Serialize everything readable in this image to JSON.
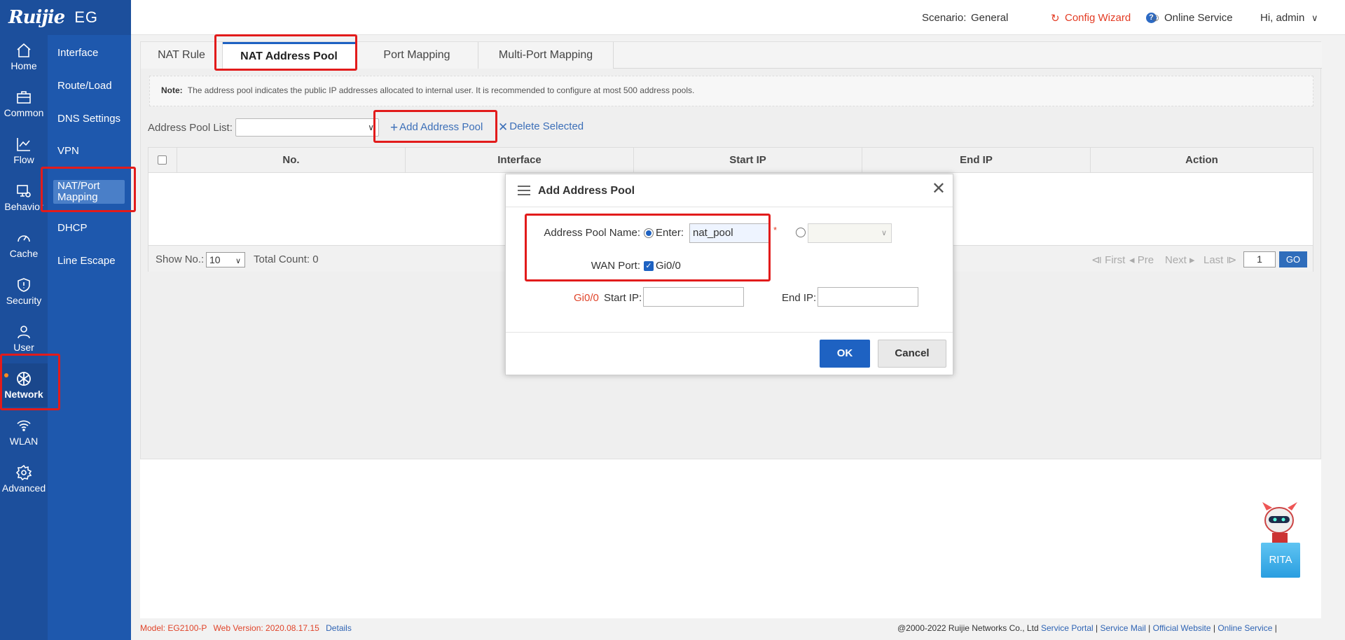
{
  "brand": {
    "logo_text": "Ruijie",
    "product": "EG"
  },
  "top_bar": {
    "scenario_label": "Scenario:",
    "scenario_value": "General",
    "config_wizard": "Config Wizard",
    "online_service": "Online Service",
    "user_greeting": "Hi, admin"
  },
  "left_nav": [
    {
      "label": "Home",
      "icon": "home-icon"
    },
    {
      "label": "Common",
      "icon": "briefcase-icon"
    },
    {
      "label": "Flow",
      "icon": "line-chart-icon"
    },
    {
      "label": "Behavior",
      "icon": "monitor-gear-icon"
    },
    {
      "label": "Cache",
      "icon": "gauge-icon"
    },
    {
      "label": "Security",
      "icon": "shield-icon"
    },
    {
      "label": "User",
      "icon": "user-icon"
    },
    {
      "label": "Network",
      "icon": "globe-icon",
      "active": true
    },
    {
      "label": "WLAN",
      "icon": "wifi-icon"
    },
    {
      "label": "Advanced",
      "icon": "gear-icon"
    }
  ],
  "sub_nav": [
    "Interface",
    "Route/Load",
    "DNS Settings",
    "VPN",
    "NAT/Port Mapping",
    "DHCP",
    "Line Escape"
  ],
  "tabs": [
    "NAT Rule",
    "NAT Address Pool",
    "Port Mapping",
    "Multi-Port Mapping"
  ],
  "note": {
    "label": "Note:",
    "text": "The address pool indicates the public IP addresses allocated to internal user. It is recommended to configure at most 500 address pools."
  },
  "pool_list": {
    "label": "Address Pool List:",
    "add_button": "Add Address Pool",
    "delete_button": "Delete Selected"
  },
  "table": {
    "columns": [
      "No.",
      "Interface",
      "Start IP",
      "End IP",
      "Action"
    ],
    "rows": []
  },
  "table_footer": {
    "show_label": "Show No.:",
    "show_value": "10",
    "total_count": "Total Count: 0",
    "first": "First",
    "prev": "Pre",
    "next": "Next",
    "last": "Last",
    "page": "1",
    "go": "GO"
  },
  "dialog": {
    "title": "Add Address Pool",
    "pool_name_label": "Address Pool Name:",
    "enter_label": "Enter:",
    "pool_name_value": "nat_pool",
    "required_mark": "*",
    "wan_port_label": "WAN Port:",
    "wan_port_option": "Gi0/0",
    "start_ip_prefix": "Gi0/0",
    "start_ip_label": "Start IP:",
    "end_ip_label": "End IP:",
    "ok": "OK",
    "cancel": "Cancel"
  },
  "status_bar": {
    "model_label": "Model:",
    "model_value": "EG2100-P",
    "web_version_label": "Web Version:",
    "web_version_value": "2020.08.17.15",
    "details": "Details",
    "copyright": "@2000-2022 Ruijie Networks Co., Ltd",
    "links": [
      "Service Portal",
      "Service Mail",
      "Official Website",
      "Online Service"
    ]
  },
  "assistant": {
    "label": "RITA"
  },
  "colors": {
    "nav_bg": "#1c4f9c",
    "accent": "#1e62c2",
    "highlight": "#e21b1b",
    "link": "#3c6fb8"
  }
}
